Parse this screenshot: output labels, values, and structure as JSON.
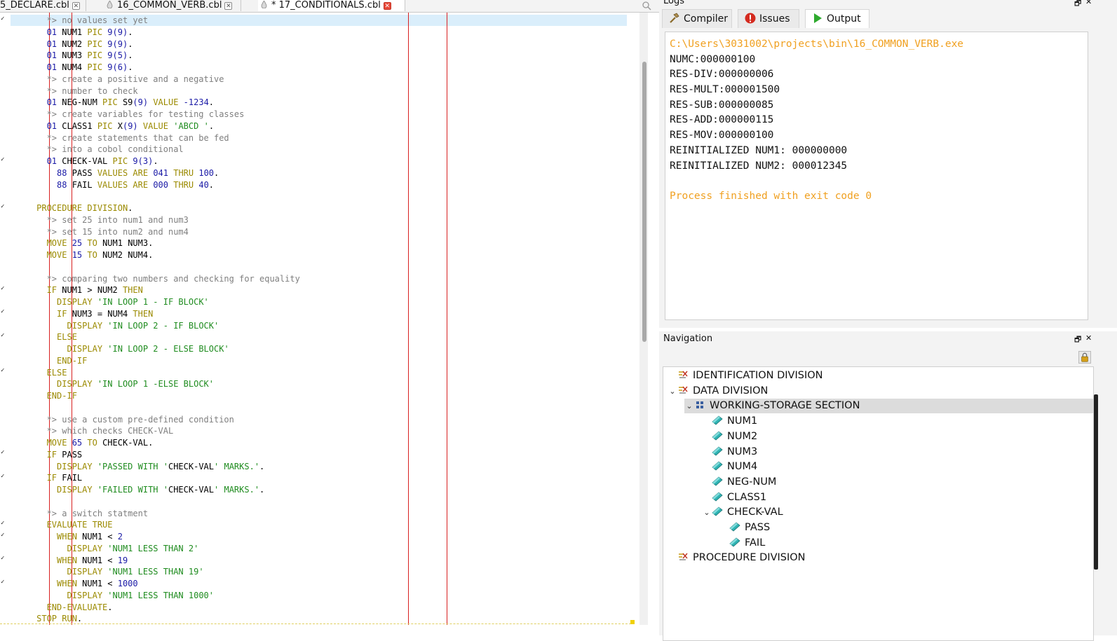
{
  "editor_tabs": [
    {
      "label": "5_DECLARE.cbl",
      "modified": false,
      "active": false
    },
    {
      "label": "16_COMMON_VERB.cbl",
      "modified": false,
      "active": false
    },
    {
      "label": "17_CONDITIONALS.cbl",
      "modified": true,
      "active": true,
      "modified_mark": "*"
    }
  ],
  "code_lines": [
    [
      [
        "cm",
        "       *> no values set yet"
      ]
    ],
    [
      [
        "num",
        "       01 "
      ],
      [
        "id",
        "NUM1 "
      ],
      [
        "kw",
        "PIC "
      ],
      [
        "num",
        "9(9)"
      ],
      [
        "id",
        "."
      ]
    ],
    [
      [
        "num",
        "       01 "
      ],
      [
        "id",
        "NUM2 "
      ],
      [
        "kw",
        "PIC "
      ],
      [
        "num",
        "9(9)"
      ],
      [
        "id",
        "."
      ]
    ],
    [
      [
        "num",
        "       01 "
      ],
      [
        "id",
        "NUM3 "
      ],
      [
        "kw",
        "PIC "
      ],
      [
        "num",
        "9(5)"
      ],
      [
        "id",
        "."
      ]
    ],
    [
      [
        "num",
        "       01 "
      ],
      [
        "id",
        "NUM4 "
      ],
      [
        "kw",
        "PIC "
      ],
      [
        "num",
        "9(6)"
      ],
      [
        "id",
        "."
      ]
    ],
    [
      [
        "cm",
        "       *> create a positive and a negative"
      ]
    ],
    [
      [
        "cm",
        "       *> number to check"
      ]
    ],
    [
      [
        "num",
        "       01 "
      ],
      [
        "id",
        "NEG-NUM "
      ],
      [
        "kw",
        "PIC "
      ],
      [
        "id",
        "S9"
      ],
      [
        "num",
        "(9) "
      ],
      [
        "kw",
        "VALUE "
      ],
      [
        "num",
        "-1234"
      ],
      [
        "id",
        "."
      ]
    ],
    [
      [
        "cm",
        "       *> create variables for testing classes"
      ]
    ],
    [
      [
        "num",
        "       01 "
      ],
      [
        "id",
        "CLASS1 "
      ],
      [
        "kw",
        "PIC "
      ],
      [
        "id",
        "X"
      ],
      [
        "num",
        "(9) "
      ],
      [
        "kw",
        "VALUE "
      ],
      [
        "str",
        "'ABCD '"
      ],
      [
        "id",
        "."
      ]
    ],
    [
      [
        "cm",
        "       *> create statements that can be fed"
      ]
    ],
    [
      [
        "cm",
        "       *> into a cobol conditional"
      ]
    ],
    [
      [
        "num",
        "       01 "
      ],
      [
        "id",
        "CHECK-VAL "
      ],
      [
        "kw",
        "PIC "
      ],
      [
        "num",
        "9(3)"
      ],
      [
        "id",
        "."
      ]
    ],
    [
      [
        "num",
        "         88 "
      ],
      [
        "id",
        "PASS "
      ],
      [
        "kw",
        "VALUES ARE "
      ],
      [
        "num",
        "041 "
      ],
      [
        "kw",
        "THRU "
      ],
      [
        "num",
        "100"
      ],
      [
        "id",
        "."
      ]
    ],
    [
      [
        "num",
        "         88 "
      ],
      [
        "id",
        "FAIL "
      ],
      [
        "kw",
        "VALUES ARE "
      ],
      [
        "num",
        "000 "
      ],
      [
        "kw",
        "THRU "
      ],
      [
        "num",
        "40"
      ],
      [
        "id",
        "."
      ]
    ],
    [
      [
        "id",
        ""
      ]
    ],
    [
      [
        "kw",
        "     PROCEDURE DIVISION"
      ],
      [
        "id",
        "."
      ]
    ],
    [
      [
        "cm",
        "       *> set 25 into num1 and num3"
      ]
    ],
    [
      [
        "cm",
        "       *> set 15 into num2 and num4"
      ]
    ],
    [
      [
        "kw",
        "       MOVE "
      ],
      [
        "num",
        "25 "
      ],
      [
        "kw",
        "TO "
      ],
      [
        "id",
        "NUM1 NUM3."
      ]
    ],
    [
      [
        "kw",
        "       MOVE "
      ],
      [
        "num",
        "15 "
      ],
      [
        "kw",
        "TO "
      ],
      [
        "id",
        "NUM2 NUM4."
      ]
    ],
    [
      [
        "id",
        ""
      ]
    ],
    [
      [
        "cm",
        "       *> comparing two numbers and checking for equality"
      ]
    ],
    [
      [
        "kw",
        "       IF "
      ],
      [
        "id",
        "NUM1 > NUM2 "
      ],
      [
        "kw",
        "THEN"
      ]
    ],
    [
      [
        "kw",
        "         DISPLAY "
      ],
      [
        "str",
        "'IN LOOP 1 - IF BLOCK'"
      ]
    ],
    [
      [
        "kw",
        "         IF "
      ],
      [
        "id",
        "NUM3 = NUM4 "
      ],
      [
        "kw",
        "THEN"
      ]
    ],
    [
      [
        "kw",
        "           DISPLAY "
      ],
      [
        "str",
        "'IN LOOP 2 - IF BLOCK'"
      ]
    ],
    [
      [
        "kw",
        "         ELSE"
      ]
    ],
    [
      [
        "kw",
        "           DISPLAY "
      ],
      [
        "str",
        "'IN LOOP 2 - ELSE BLOCK'"
      ]
    ],
    [
      [
        "kw",
        "         END-IF"
      ]
    ],
    [
      [
        "kw",
        "       ELSE"
      ]
    ],
    [
      [
        "kw",
        "         DISPLAY "
      ],
      [
        "str",
        "'IN LOOP 1 -ELSE BLOCK'"
      ]
    ],
    [
      [
        "kw",
        "       END-IF"
      ]
    ],
    [
      [
        "id",
        ""
      ]
    ],
    [
      [
        "cm",
        "       *> use a custom pre-defined condition"
      ]
    ],
    [
      [
        "cm",
        "       *> which checks CHECK-VAL"
      ]
    ],
    [
      [
        "kw",
        "       MOVE "
      ],
      [
        "num",
        "65 "
      ],
      [
        "kw",
        "TO "
      ],
      [
        "id",
        "CHECK-VAL."
      ]
    ],
    [
      [
        "kw",
        "       IF "
      ],
      [
        "id",
        "PASS"
      ]
    ],
    [
      [
        "kw",
        "         DISPLAY "
      ],
      [
        "str",
        "'PASSED WITH '"
      ],
      [
        "id",
        "CHECK-VAL"
      ],
      [
        "str",
        "' MARKS.'"
      ],
      [
        "id",
        "."
      ]
    ],
    [
      [
        "kw",
        "       IF "
      ],
      [
        "id",
        "FAIL"
      ]
    ],
    [
      [
        "kw",
        "         DISPLAY "
      ],
      [
        "str",
        "'FAILED WITH '"
      ],
      [
        "id",
        "CHECK-VAL"
      ],
      [
        "str",
        "' MARKS.'"
      ],
      [
        "id",
        "."
      ]
    ],
    [
      [
        "id",
        ""
      ]
    ],
    [
      [
        "cm",
        "       *> a switch statment"
      ]
    ],
    [
      [
        "kw",
        "       EVALUATE TRUE"
      ]
    ],
    [
      [
        "kw",
        "         WHEN "
      ],
      [
        "id",
        "NUM1 < "
      ],
      [
        "num",
        "2"
      ]
    ],
    [
      [
        "kw",
        "           DISPLAY "
      ],
      [
        "str",
        "'NUM1 LESS THAN 2'"
      ]
    ],
    [
      [
        "kw",
        "         WHEN "
      ],
      [
        "id",
        "NUM1 < "
      ],
      [
        "num",
        "19"
      ]
    ],
    [
      [
        "kw",
        "           DISPLAY "
      ],
      [
        "str",
        "'NUM1 LESS THAN 19'"
      ]
    ],
    [
      [
        "kw",
        "         WHEN "
      ],
      [
        "id",
        "NUM1 < "
      ],
      [
        "num",
        "1000"
      ]
    ],
    [
      [
        "kw",
        "           DISPLAY "
      ],
      [
        "str",
        "'NUM1 LESS THAN 1000'"
      ]
    ],
    [
      [
        "kw",
        "       END-EVALUATE"
      ],
      [
        "id",
        "."
      ]
    ],
    [
      [
        "kw",
        "     STOP RUN"
      ],
      [
        "id",
        "."
      ]
    ]
  ],
  "logs_panel": {
    "title": "Logs",
    "tabs": [
      {
        "label": "Compiler",
        "icon": "hammer-icon"
      },
      {
        "label": "Issues",
        "icon": "error-icon"
      },
      {
        "label": "Output",
        "icon": "play-icon",
        "active": true
      }
    ],
    "output_lines": [
      {
        "text": "C:\\Users\\3031002\\projects\\bin\\16_COMMON_VERB.exe",
        "kind": "path"
      },
      {
        "text": "NUMC:000000100",
        "kind": "normal"
      },
      {
        "text": "RES-DIV:000000006",
        "kind": "normal"
      },
      {
        "text": "RES-MULT:000001500",
        "kind": "normal"
      },
      {
        "text": "RES-SUB:000000085",
        "kind": "normal"
      },
      {
        "text": "RES-ADD:000000115",
        "kind": "normal"
      },
      {
        "text": "RES-MOV:000000100",
        "kind": "normal"
      },
      {
        "text": "REINITIALIZED NUM1: 000000000",
        "kind": "normal"
      },
      {
        "text": "REINITIALIZED NUM2: 000012345",
        "kind": "normal"
      },
      {
        "text": "",
        "kind": "normal"
      },
      {
        "text": "Process finished with exit code 0",
        "kind": "done"
      }
    ]
  },
  "navigation_panel": {
    "title": "Navigation",
    "tree": [
      {
        "label": "IDENTIFICATION DIVISION",
        "level": 0,
        "icon": "division-icon",
        "expandable": false
      },
      {
        "label": "DATA DIVISION",
        "level": 0,
        "icon": "division-icon",
        "expandable": true,
        "expanded": true
      },
      {
        "label": "WORKING-STORAGE SECTION",
        "level": 1,
        "icon": "section-icon",
        "expandable": true,
        "expanded": true,
        "selected": true
      },
      {
        "label": "NUM1",
        "level": 2,
        "icon": "variable-icon",
        "expandable": false
      },
      {
        "label": "NUM2",
        "level": 2,
        "icon": "variable-icon",
        "expandable": false
      },
      {
        "label": "NUM3",
        "level": 2,
        "icon": "variable-icon",
        "expandable": false
      },
      {
        "label": "NUM4",
        "level": 2,
        "icon": "variable-icon",
        "expandable": false
      },
      {
        "label": "NEG-NUM",
        "level": 2,
        "icon": "variable-icon",
        "expandable": false
      },
      {
        "label": "CLASS1",
        "level": 2,
        "icon": "variable-icon",
        "expandable": false
      },
      {
        "label": "CHECK-VAL",
        "level": 2,
        "icon": "variable-icon",
        "expandable": true,
        "expanded": true
      },
      {
        "label": "PASS",
        "level": 3,
        "icon": "variable-icon",
        "expandable": false
      },
      {
        "label": "FAIL",
        "level": 3,
        "icon": "variable-icon",
        "expandable": false
      },
      {
        "label": "PROCEDURE DIVISION",
        "level": 0,
        "icon": "division-icon",
        "expandable": false
      }
    ]
  },
  "colors": {
    "comment": "#7f7f7f",
    "keyword": "#9b8a00",
    "number": "#1a1aa6",
    "string": "#1f8c1f",
    "current_line": "#daeefb",
    "margin_line": "#d82020",
    "output_highlight": "#f0a020"
  }
}
